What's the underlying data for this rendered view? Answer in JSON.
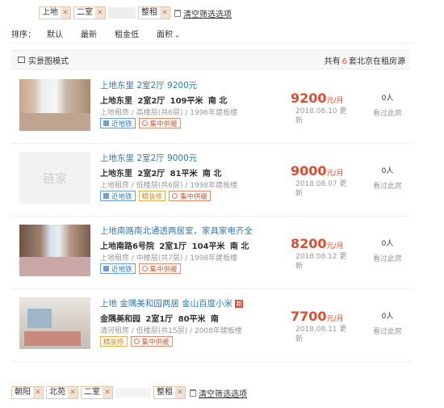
{
  "top_filters": {
    "tags": [
      {
        "label": "上地"
      },
      {
        "label": "二室"
      },
      {
        "label": ""
      },
      {
        "label": "整租"
      }
    ],
    "clear_label": "清空筛选选项"
  },
  "sort": {
    "label": "排序：",
    "options": [
      {
        "label": "默认"
      },
      {
        "label": "最新"
      },
      {
        "label": "租金低"
      },
      {
        "label": "面积"
      }
    ]
  },
  "summary": {
    "mode_label": "实景图模式",
    "count_prefix": "共有",
    "count_num": "6",
    "count_suffix": "套北京在租房源"
  },
  "listings": [
    {
      "title": "上地东里 2室2厅 9200元",
      "community": "上地东里",
      "layout": "2室2厅",
      "area": "109平米",
      "orient": "南 北",
      "meta": "上地租房 / 高楼层(共6层) / 1996年建板楼",
      "badges": [
        {
          "type": "metro",
          "label": "近地铁"
        },
        {
          "type": "heat",
          "label": "集中供暖"
        }
      ],
      "price": "9200",
      "price_unit": "元/月",
      "date": "2018.08.10 更新",
      "views": "0人",
      "views_label": "看过此房",
      "photo": "room-photo"
    },
    {
      "title": "上地东里 2室2厅 9000元",
      "community": "上地东里",
      "layout": "2室2厅",
      "area": "81平米",
      "orient": "南 北",
      "meta": "上地租房 / 低楼层(共6层) / 1998年建板楼",
      "badges": [
        {
          "type": "metro",
          "label": "近地铁"
        },
        {
          "type": "deco",
          "label": "精装修"
        },
        {
          "type": "heat",
          "label": "集中供暖"
        }
      ],
      "price": "9000",
      "price_unit": "元/月",
      "date": "2018.08.07 更新",
      "views": "0人",
      "views_label": "看过此房",
      "photo": "placeholder",
      "placeholder_text": "链家"
    },
    {
      "title": "上地南路南北通透两居室，家具家电齐全",
      "community": "上地南路6号院",
      "layout": "2室1厅",
      "area": "104平米",
      "orient": "南 北",
      "meta": "上地租房 / 中楼层(共7层) / 1998年建板楼",
      "badges": [
        {
          "type": "metro",
          "label": "近地铁"
        },
        {
          "type": "heat",
          "label": "集中供暖"
        }
      ],
      "price": "8200",
      "price_unit": "元/月",
      "date": "2018.08.12 更新",
      "views": "0人",
      "views_label": "看过此房",
      "photo": "room-photo"
    },
    {
      "title": "上地 金隅美和园两居 金山百度小米",
      "community": "金隅美和园",
      "layout": "2室1厅",
      "area": "80平米",
      "orient": "南",
      "meta": "清河租房 / 低楼层(共15层) / 2008年建板楼",
      "badges": [
        {
          "type": "deco",
          "label": "精装修"
        },
        {
          "type": "heat",
          "label": "集中供暖"
        }
      ],
      "price": "7700",
      "price_unit": "元/月",
      "date": "2018.08.11 更新",
      "views": "0人",
      "views_label": "看过此房",
      "photo": "room-photo"
    }
  ],
  "bottom_filters": {
    "tags": [
      {
        "label": "朝阳"
      },
      {
        "label": "北苑"
      },
      {
        "label": "二室"
      },
      {
        "label": ""
      },
      {
        "label": "整租"
      }
    ],
    "clear_label": "清空筛选选项"
  },
  "colors": {
    "accent_price": "#e04b2e",
    "link_blue": "#2b7bbf",
    "count_orange": "#e85a2a"
  }
}
